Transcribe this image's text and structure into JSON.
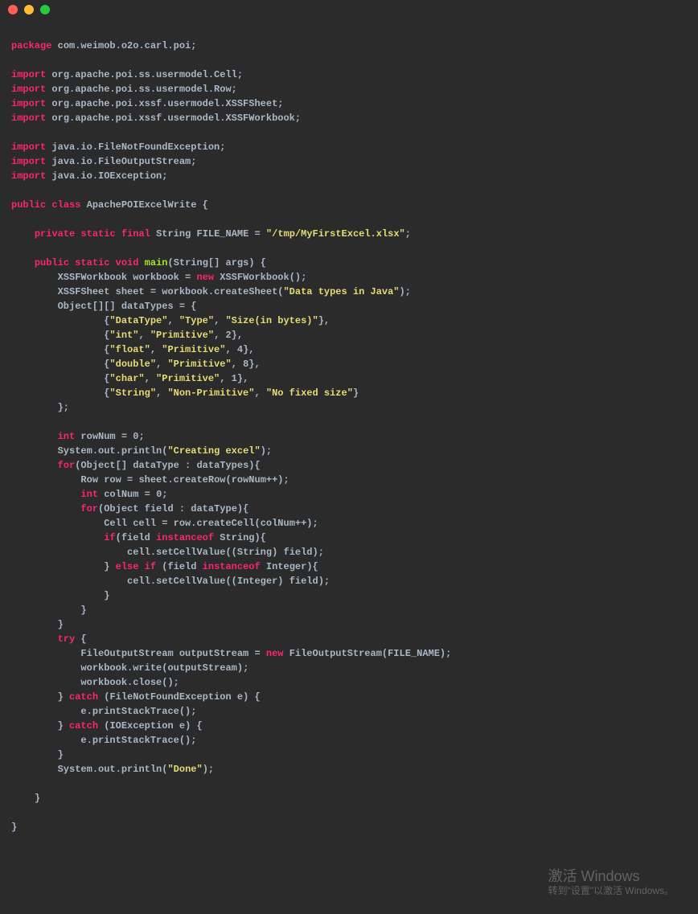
{
  "package_kw": "package",
  "package_name": "com.weimob.o2o.carl.poi",
  "import_kw": "import",
  "imports": {
    "i1": "org.apache.poi.ss.usermodel.Cell",
    "i2": "org.apache.poi.ss.usermodel.Row",
    "i3": "org.apache.poi.xssf.usermodel.XSSFSheet",
    "i4": "org.apache.poi.xssf.usermodel.XSSFWorkbook",
    "i5": "java.io.FileNotFoundException",
    "i6": "java.io.FileOutputStream",
    "i7": "java.io.IOException"
  },
  "kw": {
    "public": "public",
    "class": "class",
    "private": "private",
    "static": "static",
    "final": "final",
    "void": "void",
    "new": "new",
    "int": "int",
    "for": "for",
    "if": "if",
    "else": "else",
    "instanceof": "instanceof",
    "try": "try",
    "catch": "catch"
  },
  "class_name": "ApachePOIExcelWrite",
  "field": {
    "type": "String",
    "name": "FILE_NAME",
    "value": "\"/tmp/MyFirstExcel.xlsx\""
  },
  "main": {
    "name": "main",
    "param_type": "String[]",
    "param_name": "args"
  },
  "id": {
    "XSSFWorkbook": "XSSFWorkbook",
    "workbook": "workbook",
    "XSSFSheet": "XSSFSheet",
    "sheet": "sheet",
    "createSheet": "createSheet",
    "Object": "Object",
    "dataTypes": "dataTypes",
    "rowNum": "rowNum",
    "System": "System",
    "out": "out",
    "println": "println",
    "dataType": "dataType",
    "Row": "Row",
    "row": "row",
    "createRow": "createRow",
    "colNum": "colNum",
    "field": "field",
    "Cell": "Cell",
    "cell": "cell",
    "createCell": "createCell",
    "String": "String",
    "setCellValue": "setCellValue",
    "Integer": "Integer",
    "FileOutputStream": "FileOutputStream",
    "outputStream": "outputStream",
    "FILE_NAME": "FILE_NAME",
    "write": "write",
    "close": "close",
    "FileNotFoundException": "FileNotFoundException",
    "IOException": "IOException",
    "e": "e",
    "printStackTrace": "printStackTrace"
  },
  "str": {
    "sheet_name": "\"Data types in Java\"",
    "DataType": "\"DataType\"",
    "Type": "\"Type\"",
    "Size": "\"Size(in bytes)\"",
    "int": "\"int\"",
    "Primitive": "\"Primitive\"",
    "float": "\"float\"",
    "double": "\"double\"",
    "char": "\"char\"",
    "String": "\"String\"",
    "NonPrimitive": "\"Non-Primitive\"",
    "NoFixed": "\"No fixed size\"",
    "Creating": "\"Creating excel\"",
    "Done": "\"Done\""
  },
  "num": {
    "n0": "0",
    "n1": "1",
    "n2": "2",
    "n4": "4",
    "n8": "8"
  },
  "activate": {
    "title": "激活 Windows",
    "sub": "转到\"设置\"以激活 Windows。"
  }
}
